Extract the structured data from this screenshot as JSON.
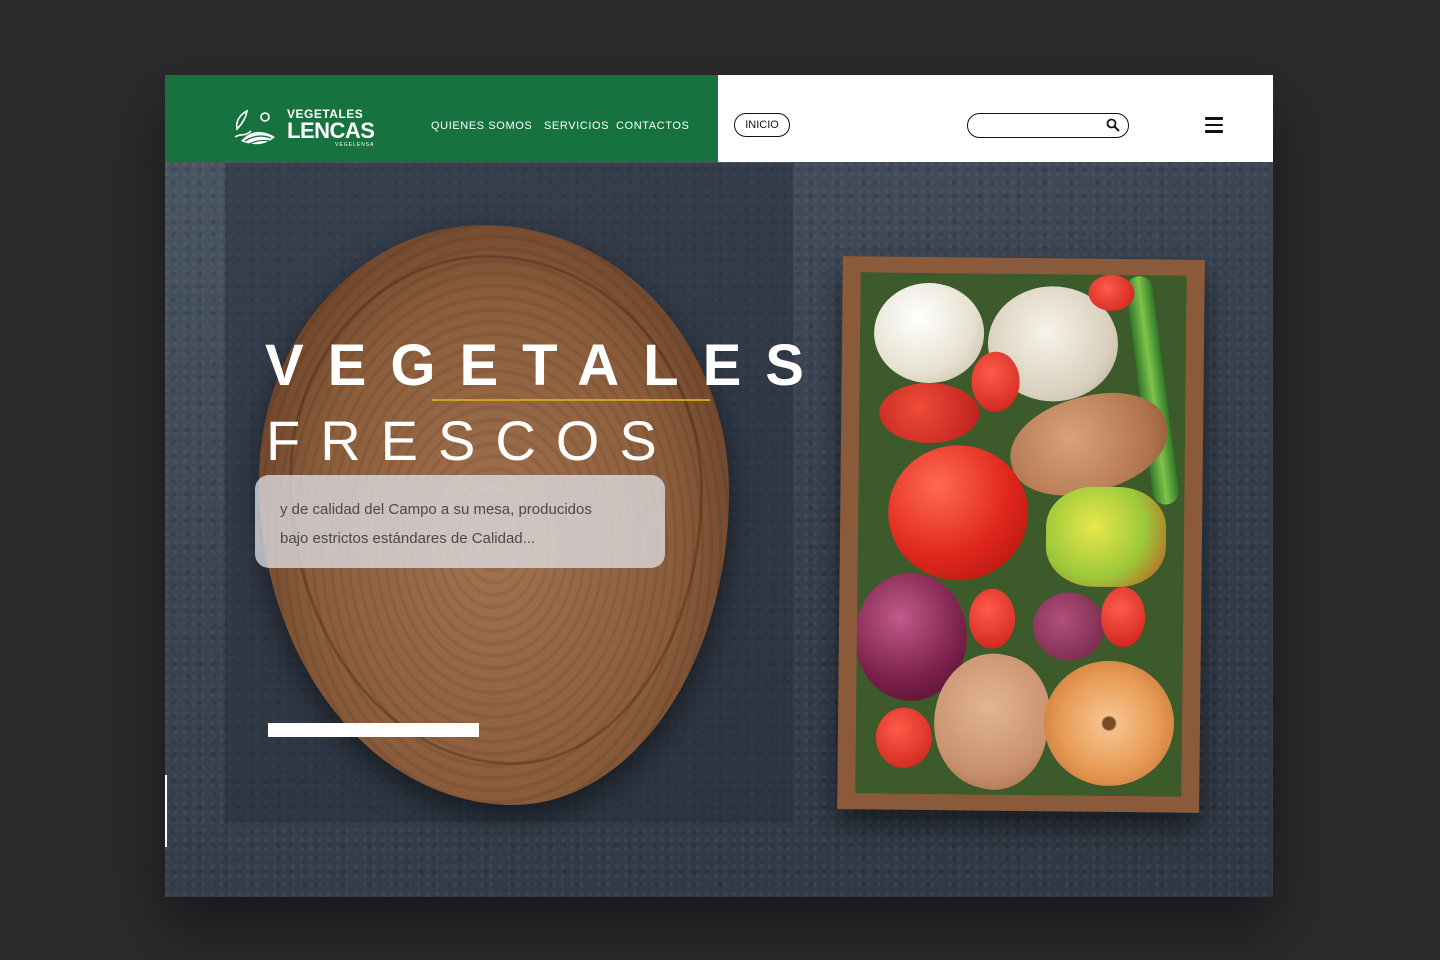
{
  "header": {
    "logo": {
      "top": "VEGETALES",
      "main": "LENCAS",
      "sub": "VEGELENSA"
    },
    "nav": [
      {
        "label": "QUIENES SOMOS"
      },
      {
        "label": "SERVICIOS"
      },
      {
        "label": "CONTACTOS"
      }
    ],
    "inicio_label": "INICIO",
    "search": {
      "placeholder": "",
      "value": ""
    }
  },
  "hero": {
    "title_line1": "VEGETALES",
    "title_line2": "FRESCOS",
    "description_line1": "y de calidad del Campo a su mesa, producidos",
    "description_line2": "bajo estrictos estándares de Calidad..."
  },
  "colors": {
    "brand_green": "#16733f",
    "accent_underline": "#d4a21a",
    "background": "#2b2b2d"
  },
  "icons": [
    "logo-leaf-icon",
    "search-icon",
    "hamburger-menu-icon"
  ]
}
